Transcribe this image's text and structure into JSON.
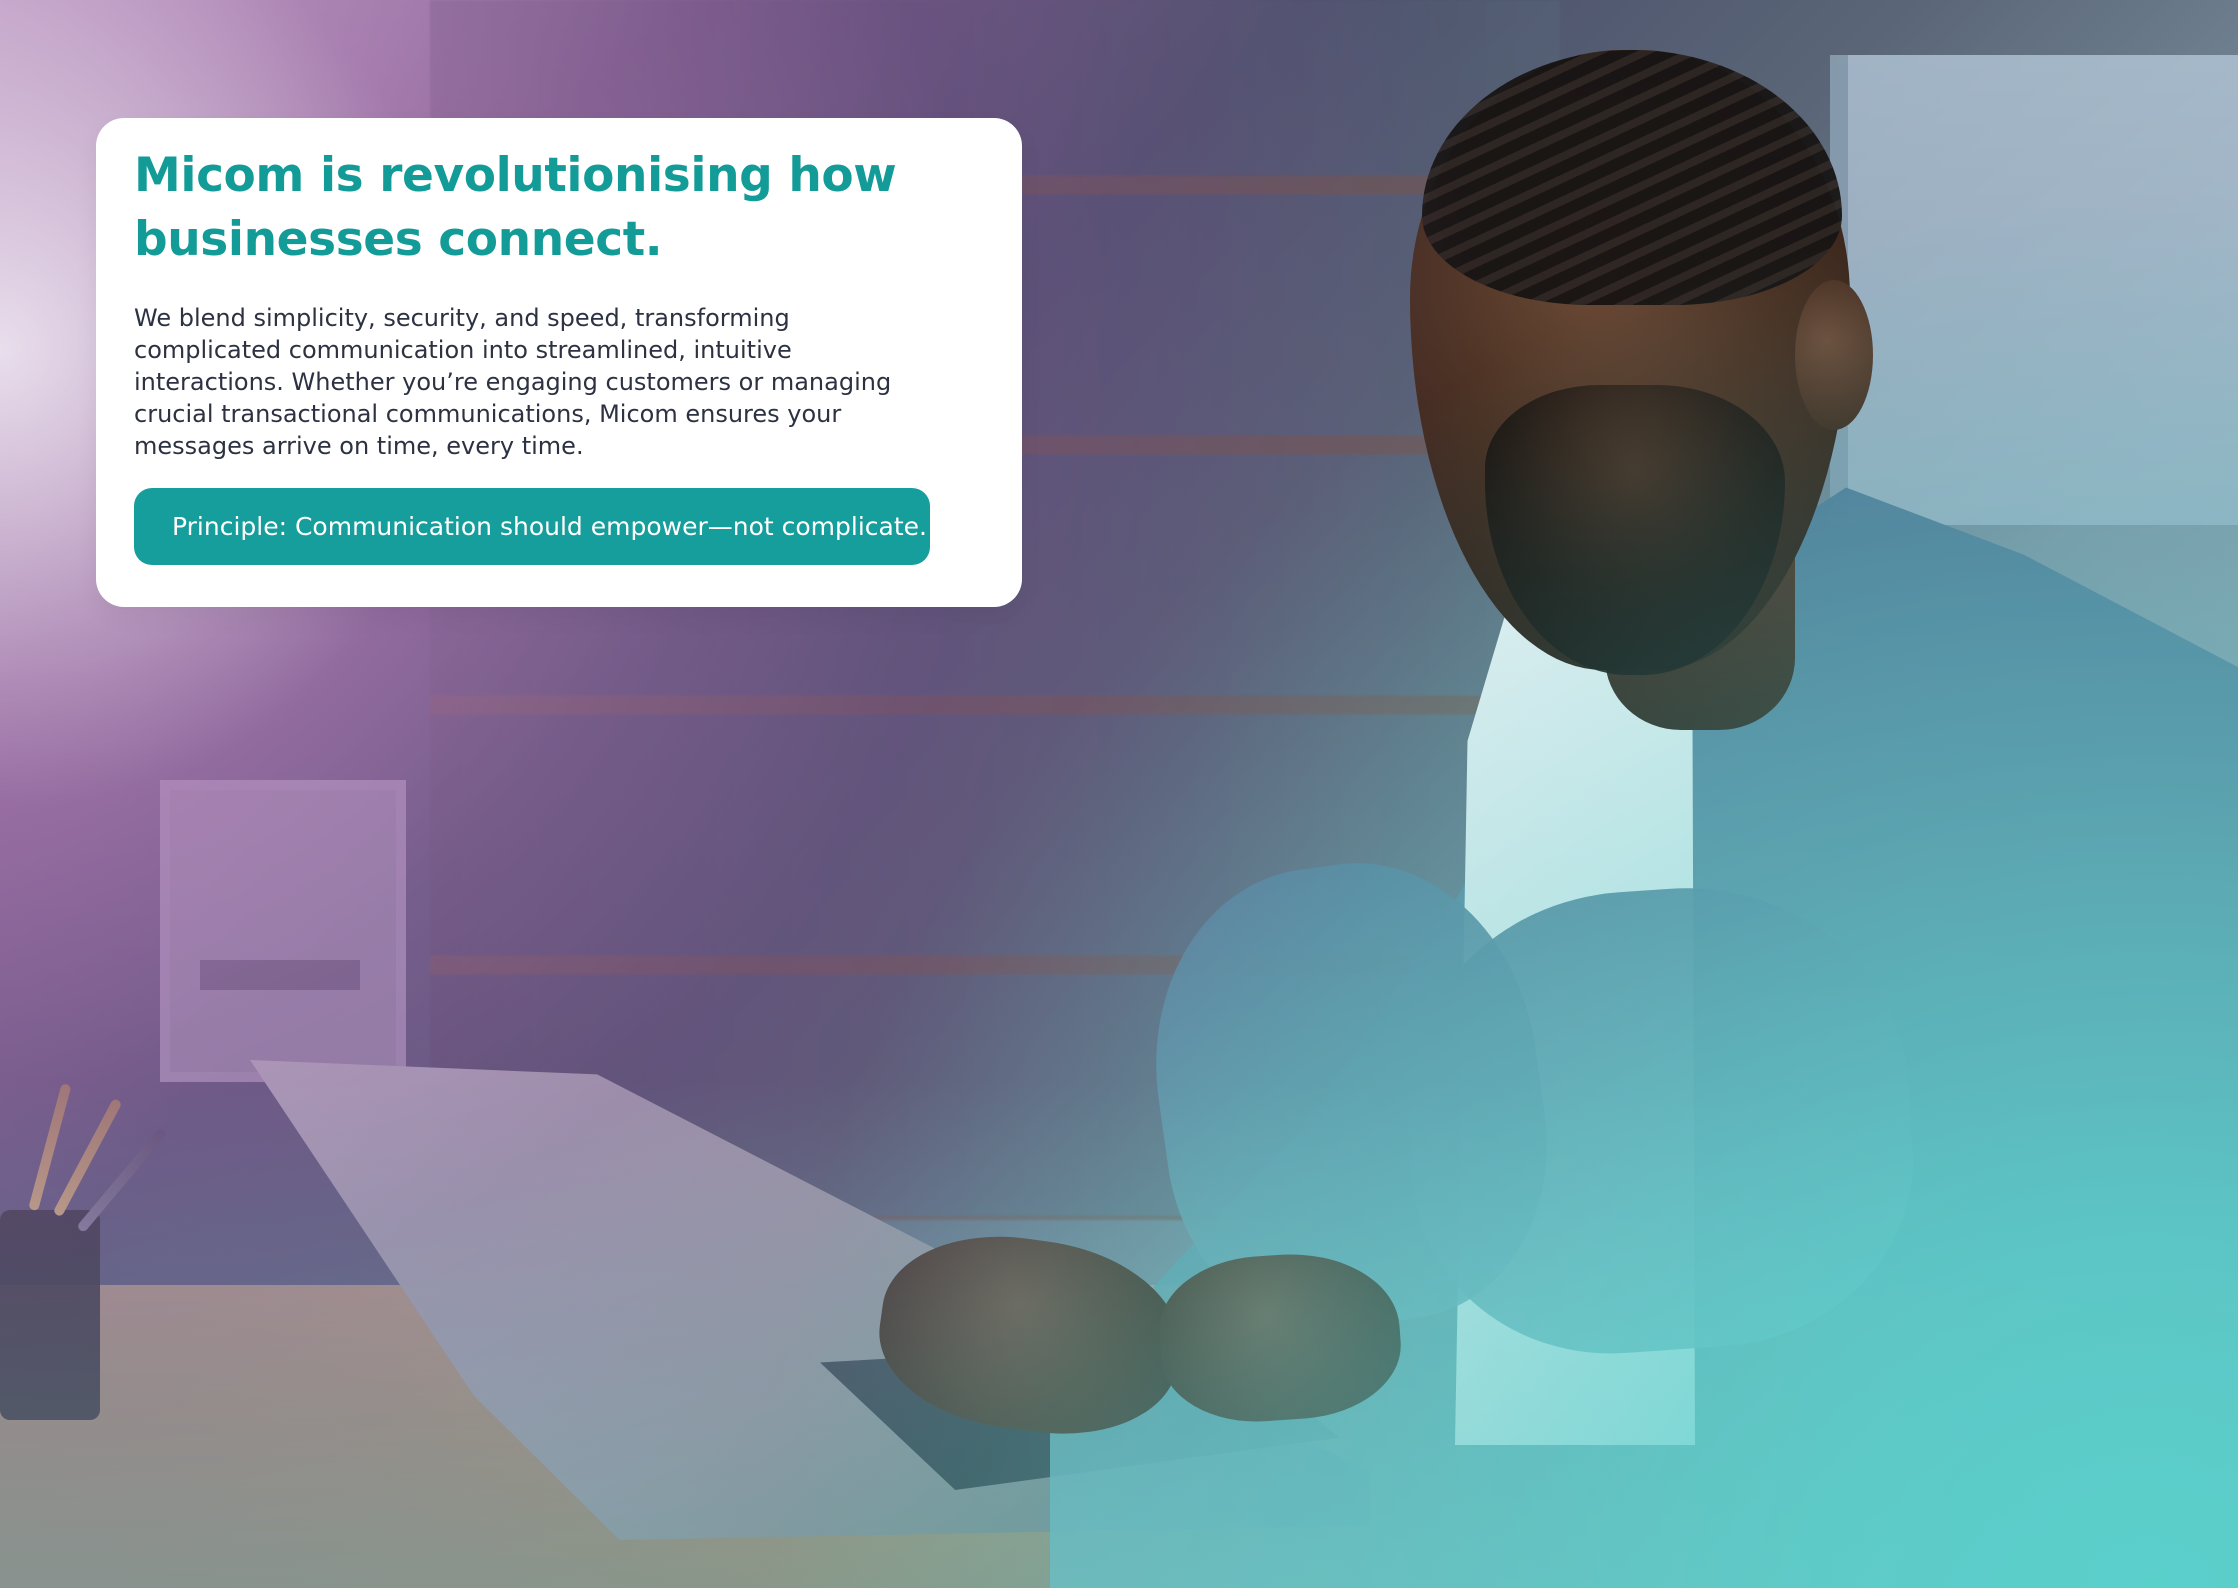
{
  "hero_card": {
    "title": "Micom is revolutionising how businesses connect.",
    "body": "We blend simplicity, security, and speed, transforming complicated communication into streamlined, intuitive interactions. Whether you’re engaging customers or managing crucial transactional communications, Micom ensures your messages arrive on time, every time.",
    "principle_label": "Principle: Communication should empower—not complicate."
  },
  "colors": {
    "accent": "#139b98",
    "button": "#159e9b",
    "body_text": "#2c3241",
    "card": "#ffffff"
  }
}
